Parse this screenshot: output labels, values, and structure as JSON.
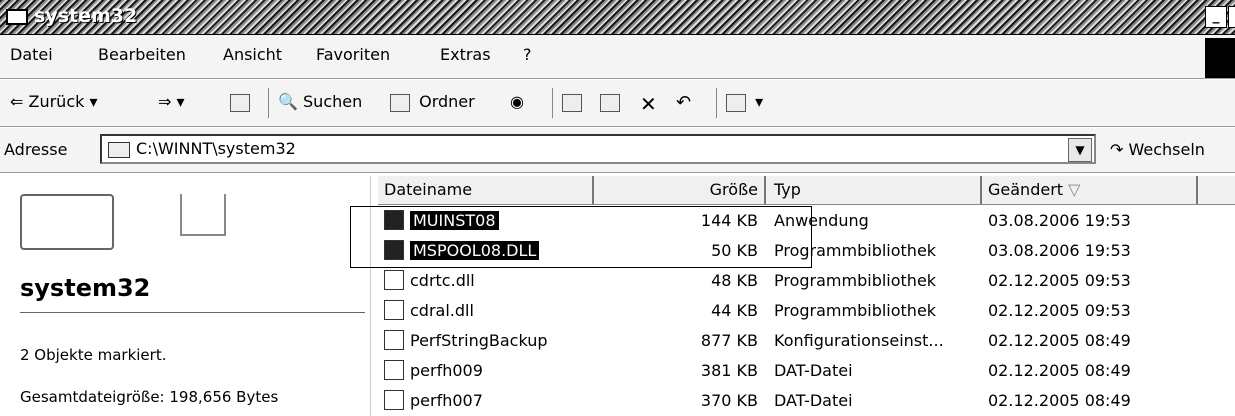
{
  "window": {
    "title": "system32"
  },
  "menubar": {
    "items": [
      "Datei",
      "Bearbeiten",
      "Ansicht",
      "Favoriten",
      "Extras",
      "?"
    ]
  },
  "toolbar": {
    "back_label": "Zurück",
    "search_label": "Suchen",
    "folders_label": "Ordner"
  },
  "addressbar": {
    "label": "Adresse",
    "value": "C:\\WINNT\\system32",
    "go_label": "Wechseln"
  },
  "leftpane": {
    "folder_title": "system32",
    "selection_info": "2 Objekte markiert.",
    "total_size": "Gesamtdateigröße: 198,656 Bytes"
  },
  "filelist": {
    "columns": [
      "Dateiname",
      "Größe",
      "Typ",
      "Geändert"
    ],
    "rows": [
      {
        "name": "MUINST08",
        "size": "144 KB",
        "type": "Anwendung",
        "modified": "03.08.2006 19:53",
        "selected": true,
        "icon": "app-icon"
      },
      {
        "name": "MSPOOL08.DLL",
        "size": "50 KB",
        "type": "Programmbibliothek",
        "modified": "03.08.2006 19:53",
        "selected": true,
        "icon": "dll-icon"
      },
      {
        "name": "cdrtc.dll",
        "size": "48 KB",
        "type": "Programmbibliothek",
        "modified": "02.12.2005 09:53",
        "selected": false,
        "icon": "dll-icon"
      },
      {
        "name": "cdral.dll",
        "size": "44 KB",
        "type": "Programmbibliothek",
        "modified": "02.12.2005 09:53",
        "selected": false,
        "icon": "dll-icon"
      },
      {
        "name": "PerfStringBackup",
        "size": "877 KB",
        "type": "Konfigurationseinst...",
        "modified": "02.12.2005 08:49",
        "selected": false,
        "icon": "config-icon"
      },
      {
        "name": "perfh009",
        "size": "381 KB",
        "type": "DAT-Datei",
        "modified": "02.12.2005 08:49",
        "selected": false,
        "icon": "dat-icon"
      },
      {
        "name": "perfh007",
        "size": "370 KB",
        "type": "DAT-Datei",
        "modified": "02.12.2005 08:49",
        "selected": false,
        "icon": "dat-icon"
      }
    ]
  }
}
